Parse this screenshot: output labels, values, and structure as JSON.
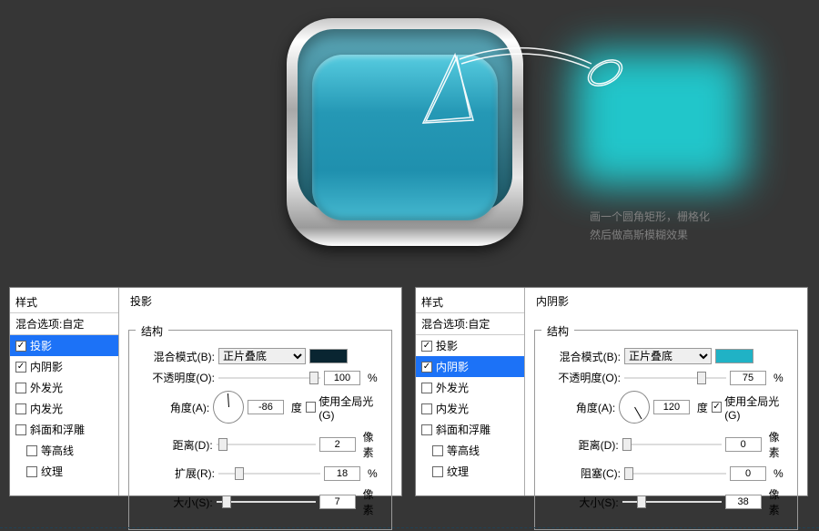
{
  "description": {
    "line1": "画一个圆角矩形，栅格化",
    "line2": "然后做高斯模糊效果"
  },
  "panel1": {
    "styles_head": "样式",
    "blend_custom": "混合选项:自定",
    "items": [
      "投影",
      "内阴影",
      "外发光",
      "内发光",
      "斜面和浮雕",
      "等高线",
      "纹理"
    ],
    "section_title": "投影",
    "structure_label": "结构",
    "blend_mode_label": "混合模式(B):",
    "blend_mode_value": "正片叠底",
    "opacity_label": "不透明度(O):",
    "opacity": "100",
    "angle_label": "角度(A):",
    "angle": "-86",
    "angle_unit": "度",
    "use_global": "使用全局光(G)",
    "distance_label": "距离(D):",
    "distance": "2",
    "spread_label": "扩展(R):",
    "spread": "18",
    "size_label": "大小(S):",
    "size": "7",
    "unit_px": "像素",
    "unit_pct": "%"
  },
  "panel2": {
    "styles_head": "样式",
    "blend_custom": "混合选项:自定",
    "items": [
      "投影",
      "内阴影",
      "外发光",
      "内发光",
      "斜面和浮雕",
      "等高线",
      "纹理"
    ],
    "section_title": "内阴影",
    "structure_label": "结构",
    "blend_mode_label": "混合模式(B):",
    "blend_mode_value": "正片叠底",
    "opacity_label": "不透明度(O):",
    "opacity": "75",
    "angle_label": "角度(A):",
    "angle": "120",
    "angle_unit": "度",
    "use_global": "使用全局光(G)",
    "distance_label": "距离(D):",
    "distance": "0",
    "choke_label": "阻塞(C):",
    "choke": "0",
    "size_label": "大小(S):",
    "size": "38",
    "unit_px": "像素",
    "unit_pct": "%"
  }
}
